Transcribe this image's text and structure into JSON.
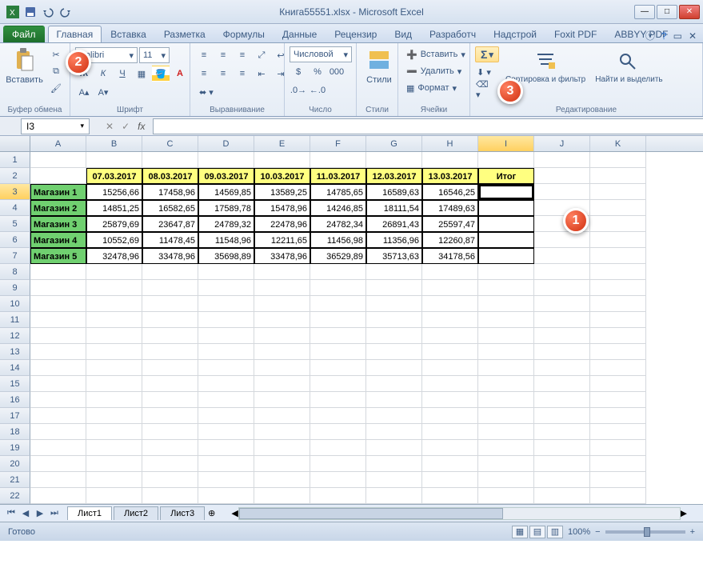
{
  "window": {
    "title": "Книга55551.xlsx - Microsoft Excel"
  },
  "tabs": {
    "file": "Файл",
    "home": "Главная",
    "insert": "Вставка",
    "layout": "Разметка",
    "formulas": "Формулы",
    "data": "Данные",
    "review": "Рецензир",
    "view": "Вид",
    "developer": "Разработч",
    "addins": "Надстрой",
    "foxit": "Foxit PDF",
    "abbyy": "ABBYY PDF"
  },
  "ribbon": {
    "paste": "Вставить",
    "clipboard": "Буфер обмена",
    "font_name": "Calibri",
    "font_size": "11",
    "font_group": "Шрифт",
    "align_group": "Выравнивание",
    "number_format": "Числовой",
    "number_group": "Число",
    "styles": "Стили",
    "styles_group": "Стили",
    "insert_menu": "Вставить",
    "delete_menu": "Удалить",
    "format_menu": "Формат",
    "cells_group": "Ячейки",
    "sort_filter": "Сортировка и фильтр",
    "find_select": "Найти и выделить",
    "editing_group": "Редактирование"
  },
  "formula_bar": {
    "name_box": "I3",
    "fx": "fx"
  },
  "columns": [
    "A",
    "B",
    "C",
    "D",
    "E",
    "F",
    "G",
    "H",
    "I",
    "J",
    "K"
  ],
  "headers": [
    "07.03.2017",
    "08.03.2017",
    "09.03.2017",
    "10.03.2017",
    "11.03.2017",
    "12.03.2017",
    "13.03.2017"
  ],
  "itog": "Итог",
  "stores": [
    "Магазин 1",
    "Магазин 2",
    "Магазин 3",
    "Магазин 4",
    "Магазин 5"
  ],
  "table": [
    [
      "15256,66",
      "17458,96",
      "14569,85",
      "13589,25",
      "14785,65",
      "16589,63",
      "16546,25"
    ],
    [
      "14851,25",
      "16582,65",
      "17589,78",
      "15478,96",
      "14246,85",
      "18111,54",
      "17489,63"
    ],
    [
      "25879,69",
      "23647,87",
      "24789,32",
      "22478,96",
      "24782,34",
      "26891,43",
      "25597,47"
    ],
    [
      "10552,69",
      "11478,45",
      "11548,96",
      "12211,65",
      "11456,98",
      "11356,96",
      "12260,87"
    ],
    [
      "32478,96",
      "33478,96",
      "35698,89",
      "33478,96",
      "36529,89",
      "35713,63",
      "34178,56"
    ]
  ],
  "sheets": {
    "s1": "Лист1",
    "s2": "Лист2",
    "s3": "Лист3"
  },
  "status": {
    "ready": "Готово",
    "zoom": "100%"
  },
  "callouts": {
    "c1": "1",
    "c2": "2",
    "c3": "3"
  },
  "chart_data": {
    "type": "table",
    "columns": [
      "07.03.2017",
      "08.03.2017",
      "09.03.2017",
      "10.03.2017",
      "11.03.2017",
      "12.03.2017",
      "13.03.2017"
    ],
    "rows": [
      "Магазин 1",
      "Магазин 2",
      "Магазин 3",
      "Магазин 4",
      "Магазин 5"
    ],
    "values": [
      [
        15256.66,
        17458.96,
        14569.85,
        13589.25,
        14785.65,
        16589.63,
        16546.25
      ],
      [
        14851.25,
        16582.65,
        17589.78,
        15478.96,
        14246.85,
        18111.54,
        17489.63
      ],
      [
        25879.69,
        23647.87,
        24789.32,
        22478.96,
        24782.34,
        26891.43,
        25597.47
      ],
      [
        10552.69,
        11478.45,
        11548.96,
        12211.65,
        11456.98,
        11356.96,
        12260.87
      ],
      [
        32478.96,
        33478.96,
        35698.89,
        33478.96,
        36529.89,
        35713.63,
        34178.56
      ]
    ]
  }
}
